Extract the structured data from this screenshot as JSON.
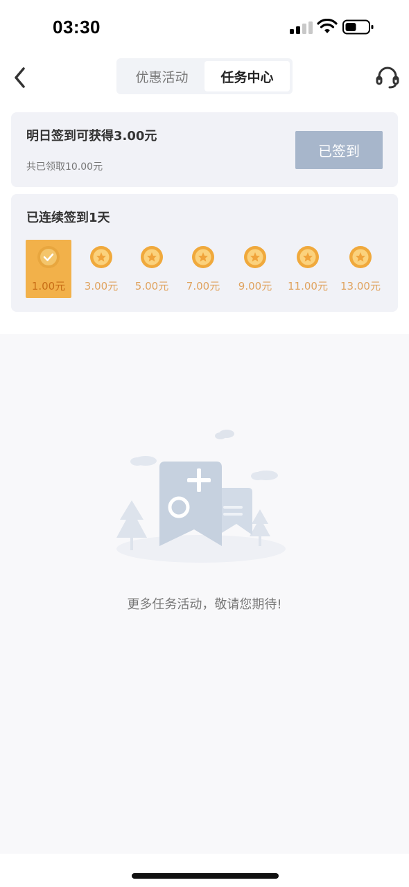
{
  "status_bar": {
    "time": "03:30",
    "icons": [
      "signal-icon",
      "wifi-icon",
      "battery-icon"
    ]
  },
  "nav": {
    "back_icon": "chevron-left-icon",
    "tabs": [
      {
        "label": "优惠活动",
        "active": false
      },
      {
        "label": "任务中心",
        "active": true
      }
    ],
    "service_icon": "headset-icon"
  },
  "checkin": {
    "tomorrow_reward": "明日签到可获得3.00元",
    "total_received": "共已领取10.00元",
    "button_label": "已签到"
  },
  "streak": {
    "title": "已连续签到1天",
    "days": [
      {
        "amount": "1.00元",
        "done": true
      },
      {
        "amount": "3.00元",
        "done": false
      },
      {
        "amount": "5.00元",
        "done": false
      },
      {
        "amount": "7.00元",
        "done": false
      },
      {
        "amount": "9.00元",
        "done": false
      },
      {
        "amount": "11.00元",
        "done": false
      },
      {
        "amount": "13.00元",
        "done": false
      }
    ]
  },
  "empty_state": {
    "illustration": "empty-tasks-illustration",
    "message": "更多任务活动，敬请您期待!"
  },
  "colors": {
    "accent_gold": "#f2b14a",
    "button_disabled": "#a7b6cb",
    "card_bg": "#f1f2f7"
  }
}
